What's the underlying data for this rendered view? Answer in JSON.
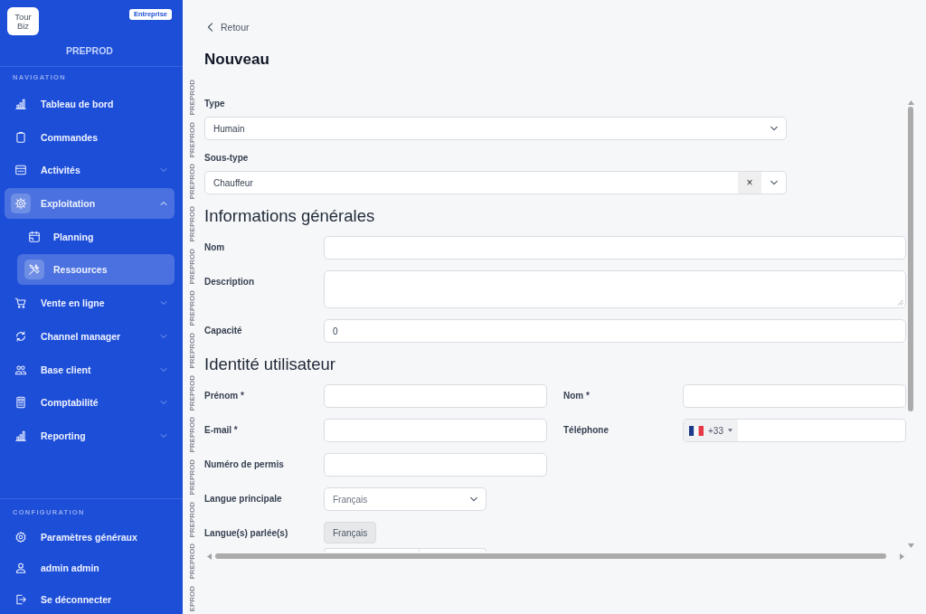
{
  "sidebar": {
    "logo": [
      "Tour",
      "Biz"
    ],
    "badge": "Entreprise",
    "environment": "PREPROD",
    "sections": [
      {
        "title": "NAVIGATION",
        "items": [
          {
            "label": "Tableau de bord",
            "kind": "link",
            "selected": false
          },
          {
            "label": "Commandes",
            "kind": "link",
            "selected": false
          },
          {
            "label": "Activités",
            "kind": "group",
            "expanded": false,
            "selected": false
          },
          {
            "label": "Exploitation",
            "kind": "group",
            "expanded": true,
            "selected": true,
            "children": [
              {
                "label": "Planning",
                "selected": false
              },
              {
                "label": "Ressources",
                "selected": true
              }
            ]
          },
          {
            "label": "Vente en ligne",
            "kind": "group",
            "expanded": false,
            "selected": false
          },
          {
            "label": "Channel manager",
            "kind": "group",
            "expanded": false,
            "selected": false
          },
          {
            "label": "Base client",
            "kind": "group",
            "expanded": false,
            "selected": false
          },
          {
            "label": "Comptabilité",
            "kind": "group",
            "expanded": false,
            "selected": false
          },
          {
            "label": "Reporting",
            "kind": "group",
            "expanded": false,
            "selected": false
          }
        ]
      },
      {
        "title": "CONFIGURATION",
        "items": [
          {
            "label": "Paramètres généraux",
            "kind": "link",
            "selected": false
          },
          {
            "label": "admin admin",
            "kind": "link",
            "selected": false
          },
          {
            "label": "Se déconnecter",
            "kind": "link",
            "selected": false
          }
        ]
      }
    ]
  },
  "environment_strip": [
    "PREPROD",
    "PREPROD",
    "PREPROD",
    "PREPROD",
    "PREPROD",
    "PREPROD",
    "PREPROD",
    "PREPROD",
    "PREPROD",
    "PREPROD",
    "PREPROD",
    "PREPROD",
    "EPROD"
  ],
  "back_link": "Retour",
  "page_title": "Nouveau",
  "form": {
    "top_fields": [
      {
        "label": "Type",
        "value": "Humain"
      },
      {
        "label": "Sous-type",
        "value": "Chauffeur",
        "clear_symbol": "×"
      }
    ],
    "sections": [
      {
        "title": "Informations générales",
        "rows": [
          {
            "fields": [
              {
                "label": "Nom",
                "kind": "text"
              }
            ]
          },
          {
            "fields": [
              {
                "label": "Description",
                "kind": "textarea"
              }
            ]
          },
          {
            "fields": [
              {
                "label": "Capacité",
                "kind": "text",
                "value": "0"
              }
            ]
          }
        ]
      },
      {
        "title": "Identité utilisateur",
        "rows": [
          {
            "fields": [
              {
                "label": "Prénom *",
                "kind": "text"
              },
              {
                "label": "Nom *",
                "kind": "text"
              }
            ]
          },
          {
            "fields": [
              {
                "label": "E-mail *",
                "kind": "text"
              },
              {
                "label": "Téléphone",
                "kind": "phone",
                "country_code": "+33"
              }
            ]
          },
          {
            "fields": [
              {
                "label": "Numéro de permis",
                "kind": "text"
              }
            ]
          },
          {
            "fields": [
              {
                "label": "Langue principale",
                "kind": "select",
                "value": "Français"
              }
            ]
          },
          {
            "fields": [
              {
                "label": "Langue(s) parlée(s)",
                "kind": "chips",
                "chips": [
                  "Français"
                ]
              }
            ]
          },
          {
            "fields": [
              {
                "kind": "split"
              }
            ]
          }
        ]
      }
    ]
  }
}
